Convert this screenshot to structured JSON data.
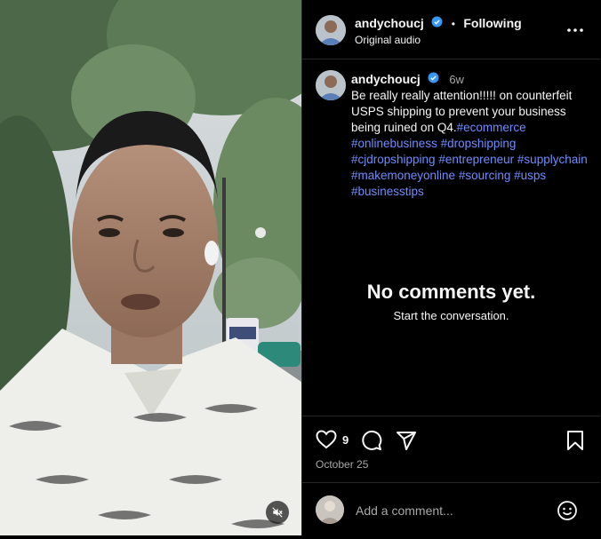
{
  "post": {
    "username": "andychoucj",
    "follow_label": "Following",
    "audio_label": "Original audio",
    "age": "6w",
    "caption_text": "Be really really attention!!!!! on counterfeit USPS shipping to prevent your business being ruined on Q4.",
    "hashtags": [
      "#ecommerce",
      "#onlinebusiness",
      "#dropshipping",
      "#cjdropshipping",
      "#entrepreneur",
      "#supplychain",
      "#makemoneyonline",
      "#sourcing",
      "#usps",
      "#businesstips"
    ]
  },
  "comments": {
    "empty_title": "No comments yet.",
    "empty_subtitle": "Start the conversation."
  },
  "actions": {
    "likes_count": "9",
    "date": "October 25"
  },
  "composer": {
    "placeholder": "Add a comment..."
  },
  "icons": {
    "verified": "verified-badge-icon",
    "more": "more-options-icon",
    "like": "heart-icon",
    "comment": "comment-bubble-icon",
    "share": "paper-plane-icon",
    "save": "bookmark-icon",
    "emoji": "emoji-icon",
    "mute": "speaker-muted-icon"
  },
  "colors": {
    "link": "#6f8cff",
    "verified": "#3897f0",
    "background": "#000000"
  }
}
